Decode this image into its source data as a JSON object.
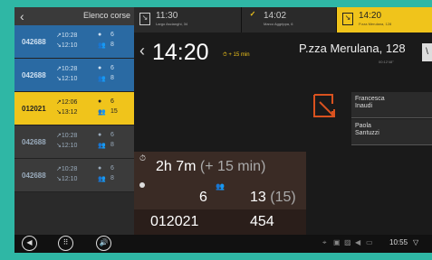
{
  "left_panel": {
    "title": "Elenco corse",
    "runs": [
      {
        "code": "042688",
        "start": "↗10:28",
        "end": "↘12:10",
        "n1": "6",
        "n2": "8",
        "style": "blue"
      },
      {
        "code": "042688",
        "start": "↗10:28",
        "end": "↘12:10",
        "n1": "6",
        "n2": "8",
        "style": "blue"
      },
      {
        "code": "012021",
        "start": "↗12:06",
        "end": "↘13:12",
        "n1": "6",
        "n2": "15",
        "style": "sel"
      },
      {
        "code": "042688",
        "start": "↗10:28",
        "end": "↘12:10",
        "n1": "6",
        "n2": "8",
        "style": "grey"
      },
      {
        "code": "042688",
        "start": "↗10:28",
        "end": "↘12:10",
        "n1": "6",
        "n2": "8",
        "style": "grey"
      }
    ]
  },
  "tabs": [
    {
      "time": "11:30",
      "place": "Largo Ascianghi, 34"
    },
    {
      "time": "14:02",
      "place": "Marco Aggrippa, 6"
    },
    {
      "time": "14:20",
      "place": "P.zza Merulana, 128"
    }
  ],
  "main": {
    "time": "14:20",
    "delay": "+ 15 min",
    "stop_name": "P.zza Merulana, 128",
    "stop_sub": "00:12'48\"",
    "next_label": "\\"
  },
  "passengers": [
    {
      "name": "Francesca\nInaudi"
    },
    {
      "name": "Paola\nSantuzzi"
    }
  ],
  "info": {
    "duration": "2h 7m",
    "duration_plus": "(+ 15 min)",
    "onboard": "6",
    "total": "13",
    "total_paren": "(15)",
    "vehicle_code": "012021",
    "vehicle_number": "454"
  },
  "statusbar": {
    "clock": "10:55"
  },
  "colors": {
    "accent": "#f0c41b",
    "blue": "#2a6aa3",
    "outer": "#2fb7a5"
  }
}
